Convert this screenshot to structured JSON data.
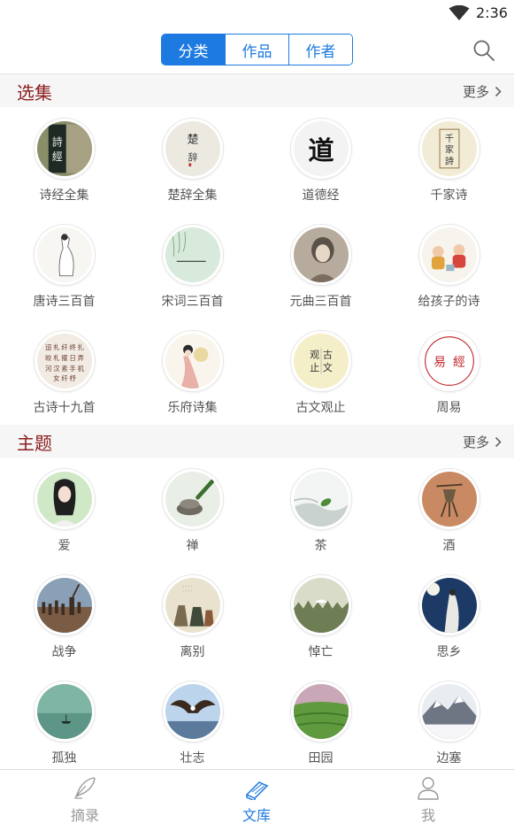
{
  "status_bar": {
    "time": "2:36"
  },
  "header": {
    "tabs": [
      {
        "label": "分类",
        "active": true
      },
      {
        "label": "作品",
        "active": false
      },
      {
        "label": "作者",
        "active": false
      }
    ]
  },
  "sections": [
    {
      "title": "选集",
      "more_label": "更多",
      "items": [
        {
          "label": "诗经全集",
          "icon": "shijing-cover",
          "glyph": "诗經"
        },
        {
          "label": "楚辞全集",
          "icon": "chuci-cover",
          "glyph": "楚辞"
        },
        {
          "label": "道德经",
          "icon": "daodejing-cover",
          "glyph": "道"
        },
        {
          "label": "千家诗",
          "icon": "qianjiashi-cover",
          "glyph": "千家詩"
        },
        {
          "label": "唐诗三百首",
          "icon": "tang-poet-painting",
          "glyph": ""
        },
        {
          "label": "宋词三百首",
          "icon": "song-landscape-painting",
          "glyph": ""
        },
        {
          "label": "元曲三百首",
          "icon": "opera-figure-painting",
          "glyph": ""
        },
        {
          "label": "给孩子的诗",
          "icon": "children-painting",
          "glyph": ""
        },
        {
          "label": "古诗十九首",
          "icon": "calligraphy-scroll",
          "glyph": ""
        },
        {
          "label": "乐府诗集",
          "icon": "lady-painting",
          "glyph": ""
        },
        {
          "label": "古文观止",
          "icon": "guwen-cover",
          "glyph": "古文观止"
        },
        {
          "label": "周易",
          "icon": "zhouyi-seal",
          "glyph": "易經"
        }
      ]
    },
    {
      "title": "主题",
      "more_label": "更多",
      "items": [
        {
          "label": "爱",
          "icon": "love-portrait",
          "glyph": ""
        },
        {
          "label": "禅",
          "icon": "zen-stone-brush",
          "glyph": ""
        },
        {
          "label": "茶",
          "icon": "tea-leaf-mist",
          "glyph": ""
        },
        {
          "label": "酒",
          "icon": "wine-vessel",
          "glyph": ""
        },
        {
          "label": "战争",
          "icon": "war-battle",
          "glyph": ""
        },
        {
          "label": "离别",
          "icon": "farewell-figures",
          "glyph": ""
        },
        {
          "label": "悼亡",
          "icon": "mourning-cranes",
          "glyph": ""
        },
        {
          "label": "思乡",
          "icon": "homesick-moon",
          "glyph": ""
        },
        {
          "label": "孤独",
          "icon": "lonely-boat",
          "glyph": ""
        },
        {
          "label": "壮志",
          "icon": "eagle-ambition",
          "glyph": ""
        },
        {
          "label": "田园",
          "icon": "fields-landscape",
          "glyph": ""
        },
        {
          "label": "边塞",
          "icon": "frontier-snow",
          "glyph": ""
        }
      ]
    }
  ],
  "bottom_nav": [
    {
      "label": "摘录",
      "icon": "quill-pen-icon",
      "active": false
    },
    {
      "label": "文库",
      "icon": "library-books-icon",
      "active": true
    },
    {
      "label": "我",
      "icon": "person-icon",
      "active": false
    }
  ],
  "colors": {
    "accent": "#1d7ae0",
    "section_title": "#8b1e1e",
    "section_bg": "#f6f6f6"
  }
}
